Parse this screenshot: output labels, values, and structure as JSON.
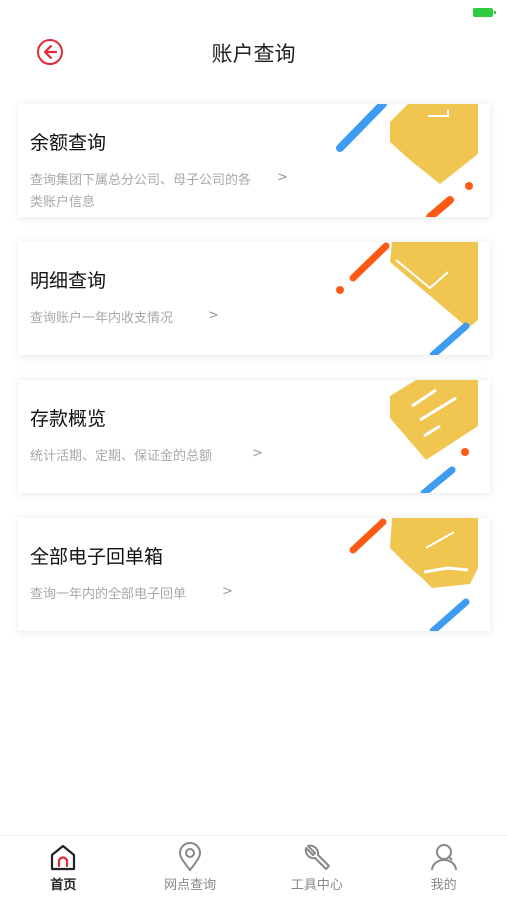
{
  "header": {
    "title": "账户查询"
  },
  "cards": [
    {
      "title": "余额查询",
      "desc": "查询集团下属总分公司、母子公司的各类账户信息",
      "arrow": ">"
    },
    {
      "title": "明细查询",
      "desc": "查询账户一年内收支情况",
      "arrow": ">"
    },
    {
      "title": "存款概览",
      "desc": "统计活期、定期、保证金的总额",
      "arrow": ">"
    },
    {
      "title": "全部电子回单箱",
      "desc": "查询一年内的全部电子回单",
      "arrow": ">"
    }
  ],
  "tabbar": {
    "items": [
      {
        "label": "首页",
        "icon": "home-icon",
        "active": true
      },
      {
        "label": "网点查询",
        "icon": "location-icon",
        "active": false
      },
      {
        "label": "工具中心",
        "icon": "wrench-icon",
        "active": false
      },
      {
        "label": "我的",
        "icon": "user-icon",
        "active": false
      }
    ]
  },
  "colors": {
    "accent_red": "#e02a3a",
    "art_yellow": "#f0c650",
    "art_blue": "#3d9cf0",
    "art_orange": "#ff5a14",
    "battery_green": "#2ecc40"
  }
}
